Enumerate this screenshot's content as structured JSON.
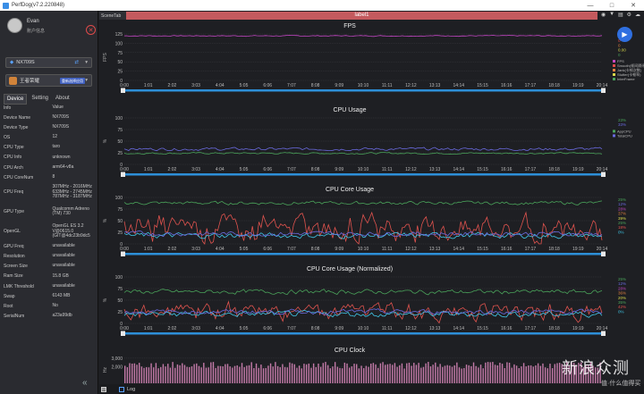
{
  "window": {
    "title": "PerfDog(v7.2.220848)"
  },
  "user": {
    "name": "Evan",
    "account": "账户信息"
  },
  "device": {
    "name": "NX709S"
  },
  "app": {
    "name": "王者荣耀",
    "tag": "重新选择应用"
  },
  "tabs": [
    {
      "label": "Device"
    },
    {
      "label": "Setting"
    },
    {
      "label": "About"
    }
  ],
  "info": {
    "headers": {
      "key": "Info",
      "value": "Value"
    },
    "rows": [
      {
        "k": "Device Name",
        "v": "NX709S"
      },
      {
        "k": "Device Type",
        "v": "NX709S"
      },
      {
        "k": "OS",
        "v": "12"
      },
      {
        "k": "CPU Type",
        "v": "taro"
      },
      {
        "k": "CPU Info",
        "v": "unknown"
      },
      {
        "k": "CPU Arch",
        "v": "arm64-v8a"
      },
      {
        "k": "CPU CoreNum",
        "v": "8"
      },
      {
        "k": "CPU Freq",
        "v": "307MHz - 2016MHz 633MHz - 2745MHz 787MHz - 3187MHz"
      },
      {
        "k": "GPU Type",
        "v": "Qualcomm Adreno (TM) 730"
      },
      {
        "k": "OpenGL",
        "v": "OpenGL ES 3.2 V@0615.0 (GIT@4dc23b9dc5"
      },
      {
        "k": "GPU Freq",
        "v": "unavailable"
      },
      {
        "k": "Resolution",
        "v": "unavailable"
      },
      {
        "k": "Screen Size",
        "v": "unavailable"
      },
      {
        "k": "Ram Size",
        "v": "15.8 GB"
      },
      {
        "k": "LMK Threshold",
        "v": "unavailable"
      },
      {
        "k": "Swap",
        "v": "6143 MB"
      },
      {
        "k": "Root",
        "v": "No"
      },
      {
        "k": "SerialNum",
        "v": "a23a99db"
      }
    ]
  },
  "strip": {
    "scene_tab": "SceneTab",
    "label": "label1"
  },
  "bottom": {
    "log_label": "Log"
  },
  "watermark": {
    "text": "新浪众测",
    "site": "值·什么值得买"
  },
  "colors": {
    "fps": "#c447c4",
    "cpu_app": "#4aa35a",
    "cpu_total": "#6a6adf",
    "core_red": "#e0534e",
    "core_cyan": "#3fc7e8",
    "timeline": "#2d8fd8",
    "label_bar": "#c45a5e"
  },
  "chart_data": [
    {
      "type": "line",
      "title": "FPS",
      "ylabel": "FPS",
      "ylim": [
        0,
        125
      ],
      "y_ticks": [
        "125",
        "100",
        "75",
        "50",
        "25",
        "0"
      ],
      "x_ticks": [
        "0:00",
        "1:01",
        "2:02",
        "3:03",
        "4:04",
        "5:05",
        "6:06",
        "7:07",
        "8:08",
        "9:09",
        "10:10",
        "11:11",
        "12:12",
        "13:13",
        "14:14",
        "15:15",
        "16:16",
        "17:17",
        "18:18",
        "19:19",
        "20:14"
      ],
      "series": [
        {
          "name": "FPS",
          "color": "#c447c4",
          "level": 120,
          "noise": 2
        }
      ],
      "legend": [
        "FPS",
        "Smooth(帧间隔评)",
        "Jank(卡顿次数)",
        "Stutter(卡顿率)",
        "InterFrame"
      ],
      "readouts": [
        "120",
        "0",
        "0",
        "0.00",
        "0"
      ],
      "readout_colors": [
        "#c447c4",
        "#e04a4a",
        "#e08040",
        "#d8d84a",
        "#4aa35a"
      ]
    },
    {
      "type": "line",
      "title": "CPU Usage",
      "ylabel": "%",
      "ylim": [
        0,
        100
      ],
      "y_ticks": [
        "100",
        "75",
        "50",
        "25",
        "0"
      ],
      "x_ticks": [
        "0:00",
        "1:01",
        "2:02",
        "3:03",
        "4:04",
        "5:05",
        "6:06",
        "7:07",
        "8:08",
        "9:09",
        "10:10",
        "11:11",
        "12:12",
        "13:13",
        "14:14",
        "15:15",
        "16:16",
        "17:17",
        "18:18",
        "19:19",
        "20:14"
      ],
      "series": [
        {
          "name": "AppCPU",
          "color": "#4aa35a",
          "level": 24,
          "noise": 3
        },
        {
          "name": "TotalCPU",
          "color": "#6a6adf",
          "level": 33,
          "noise": 5
        }
      ],
      "legend": [
        "AppCPU",
        "TotalCPU"
      ],
      "readouts": [
        "23%",
        "33%"
      ],
      "readout_colors": [
        "#4aa35a",
        "#6a6adf"
      ]
    },
    {
      "type": "line",
      "title": "CPU Core Usage",
      "ylabel": "%",
      "ylim": [
        0,
        100
      ],
      "y_ticks": [
        "100",
        "75",
        "50",
        "25",
        "0"
      ],
      "x_ticks": [
        "0:00",
        "1:01",
        "2:02",
        "3:03",
        "4:04",
        "5:05",
        "6:06",
        "7:07",
        "8:08",
        "9:09",
        "10:10",
        "11:11",
        "12:12",
        "13:13",
        "14:14",
        "15:15",
        "16:16",
        "17:17",
        "18:18",
        "19:19",
        "20:14"
      ],
      "series": [
        {
          "name": "CPU0",
          "color": "#4aa35a",
          "level": 88,
          "noise": 6
        },
        {
          "name": "CPU1",
          "color": "#e0534e",
          "level": 25,
          "noise": 45
        },
        {
          "name": "CPU2",
          "color": "#3fc7e8",
          "level": 18,
          "noise": 10
        },
        {
          "name": "CPU3",
          "color": "#6a6adf",
          "level": 22,
          "noise": 8
        }
      ],
      "readouts": [
        "25%",
        "12%",
        "28%",
        "37%",
        "39%",
        "25%",
        "18%",
        "0%"
      ],
      "readout_colors": [
        "#4aa35a",
        "#6a6adf",
        "#c447c4",
        "#e08040",
        "#d8d84a",
        "#4aa35a",
        "#e0534e",
        "#3fc7e8"
      ]
    },
    {
      "type": "line",
      "title": "CPU Core Usage (Normalized)",
      "ylabel": "%",
      "ylim": [
        0,
        100
      ],
      "y_ticks": [
        "100",
        "75",
        "50",
        "25",
        "0"
      ],
      "x_ticks": [
        "0:00",
        "1:01",
        "2:02",
        "3:03",
        "4:04",
        "5:05",
        "6:06",
        "7:07",
        "8:08",
        "9:09",
        "10:10",
        "11:11",
        "12:12",
        "13:13",
        "14:14",
        "15:15",
        "16:16",
        "17:17",
        "18:18",
        "19:19",
        "20:14"
      ],
      "series": [
        {
          "name": "CPU0",
          "color": "#4aa35a",
          "level": 68,
          "noise": 8
        },
        {
          "name": "CPU1",
          "color": "#e0534e",
          "level": 22,
          "noise": 28
        },
        {
          "name": "CPU2",
          "color": "#3fc7e8",
          "level": 20,
          "noise": 10
        },
        {
          "name": "CPU3",
          "color": "#6a6adf",
          "level": 25,
          "noise": 8
        }
      ],
      "readouts": [
        "25%",
        "12%",
        "28%",
        "36%",
        "20%",
        "35%",
        "42%",
        "0%"
      ],
      "readout_colors": [
        "#4aa35a",
        "#6a6adf",
        "#c447c4",
        "#e08040",
        "#d8d84a",
        "#4aa35a",
        "#e0534e",
        "#3fc7e8"
      ]
    },
    {
      "type": "bar",
      "title": "CPU Clock",
      "ylabel": "Hz",
      "ylim": [
        0,
        3200
      ],
      "y_ticks": [
        "3,000",
        "2,000"
      ],
      "series": [
        {
          "name": "CPU Clock",
          "color": "#e08bc0",
          "level": 2000,
          "noise": 400
        }
      ]
    }
  ]
}
